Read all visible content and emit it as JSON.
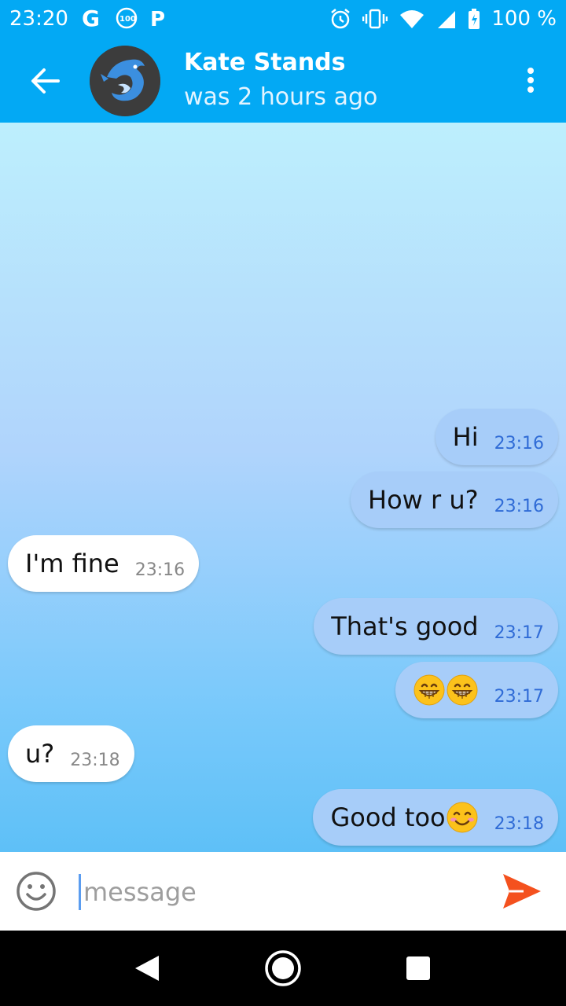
{
  "status_bar": {
    "time": "23:20",
    "left_icons": [
      "google-icon",
      "data-saver-icon",
      "parking-icon"
    ],
    "battery": "100 %",
    "right_icons": [
      "alarm-icon",
      "vibrate-icon",
      "wifi-icon",
      "signal-icon",
      "battery-icon"
    ]
  },
  "header": {
    "contact_name": "Kate Stands",
    "contact_status": "was 2 hours ago",
    "back_icon": "arrow-back-icon",
    "menu_icon": "more-vert-icon",
    "avatar_icon": "dolphin-avatar"
  },
  "messages": [
    {
      "direction": "out",
      "text": "Hi",
      "time": "23:16"
    },
    {
      "direction": "out",
      "text": "How r u?",
      "time": "23:16"
    },
    {
      "direction": "in",
      "text": "I'm fine",
      "time": "23:16"
    },
    {
      "direction": "out",
      "text": "That's good",
      "time": "23:17"
    },
    {
      "direction": "out",
      "text": "",
      "emoji": [
        "grinning-face",
        "grinning-face"
      ],
      "time": "23:17"
    },
    {
      "direction": "in",
      "text": "u?",
      "time": "23:18"
    },
    {
      "direction": "out",
      "text": "Good too",
      "emoji": [
        "smiling-face-blush"
      ],
      "time": "23:18"
    }
  ],
  "composer": {
    "placeholder": "message",
    "value": "",
    "emoji_icon": "smiley-icon",
    "send_icon": "send-icon"
  },
  "colors": {
    "header_bg": "#03a9f4",
    "outgoing_bubble": "#a7cdf9",
    "incoming_bubble": "#ffffff",
    "send_accent": "#f4511e"
  }
}
